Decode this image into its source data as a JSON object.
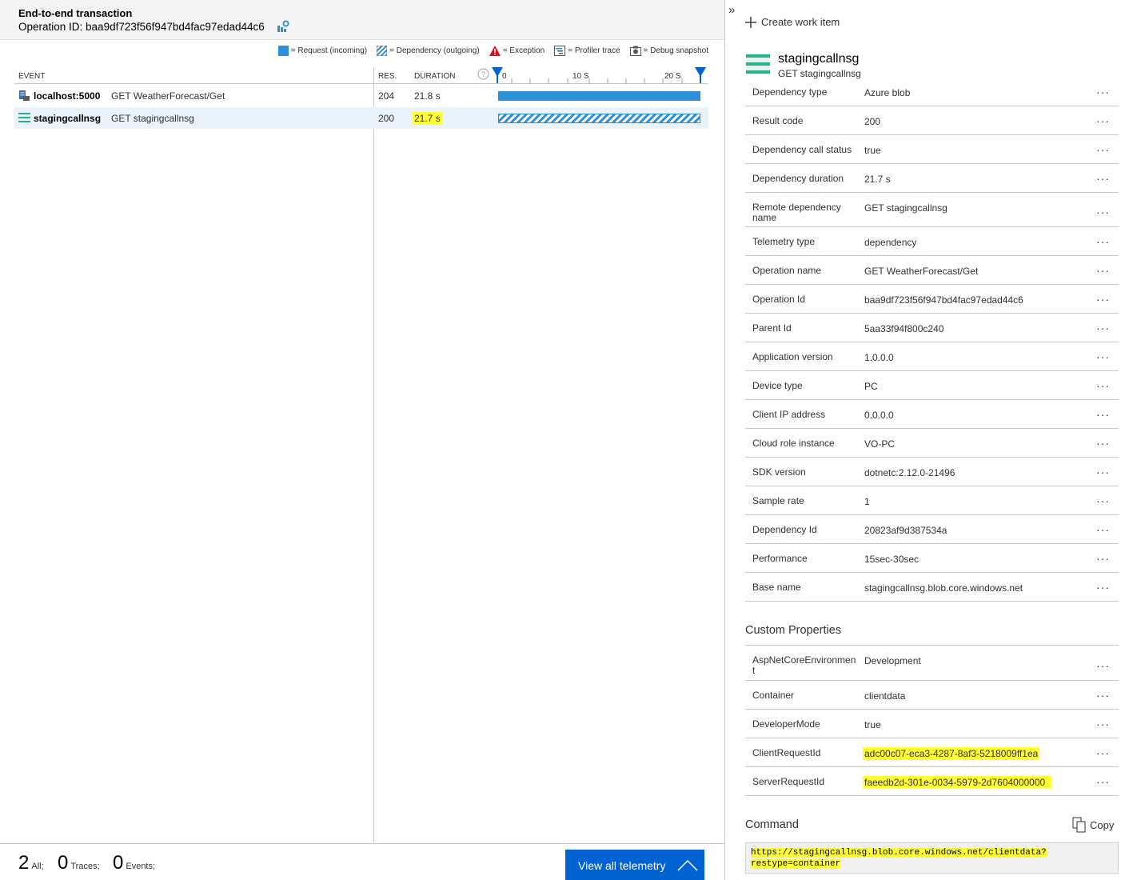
{
  "header": {
    "title": "End-to-end transaction",
    "operation_label": "Operation ID: baa9df723f56f947bd4fac97edad44c6"
  },
  "legend": {
    "request": "= Request (incoming)",
    "dependency": "= Dependency (outgoing)",
    "exception": "= Exception",
    "profiler": "= Profiler trace",
    "snapshot": "= Debug snapshot"
  },
  "columns": {
    "event": "EVENT",
    "res": "RES.",
    "duration": "DURATION",
    "tick0": "0",
    "tick10": "10 S",
    "tick20": "20 S"
  },
  "rows": [
    {
      "source": "localhost:5000",
      "name": "GET WeatherForecast/Get",
      "res": "204",
      "duration": "21.8 s",
      "icon": "server-icon"
    },
    {
      "source": "stagingcallnsg",
      "name": "GET stagingcallnsg",
      "res": "200",
      "duration": "21.7 s",
      "icon": "storage-icon"
    }
  ],
  "footer": {
    "all_count": "2",
    "all_label": "All;",
    "traces_count": "0",
    "traces_label": "Traces;",
    "events_count": "0",
    "events_label": "Events;",
    "view_all": "View all telemetry"
  },
  "details": {
    "create_work_item": "Create work item",
    "title": "stagingcallnsg",
    "subtitle": "GET stagingcallnsg",
    "properties": [
      {
        "key": "Dependency type",
        "value": "Azure blob"
      },
      {
        "key": "Result code",
        "value": "200"
      },
      {
        "key": "Dependency call status",
        "value": "true"
      },
      {
        "key": "Dependency duration",
        "value": "21.7 s"
      },
      {
        "key": "Remote dependency name",
        "value": "GET stagingcallnsg"
      },
      {
        "key": "Telemetry type",
        "value": "dependency"
      },
      {
        "key": "Operation name",
        "value": "GET WeatherForecast/Get"
      },
      {
        "key": "Operation Id",
        "value": "baa9df723f56f947bd4fac97edad44c6"
      },
      {
        "key": "Parent Id",
        "value": "5aa33f94f800c240"
      },
      {
        "key": "Application version",
        "value": "1.0.0.0"
      },
      {
        "key": "Device type",
        "value": "PC"
      },
      {
        "key": "Client IP address",
        "value": "0.0.0.0"
      },
      {
        "key": "Cloud role instance",
        "value": "VO-PC"
      },
      {
        "key": "SDK version",
        "value": "dotnetc:2.12.0-21496"
      },
      {
        "key": "Sample rate",
        "value": "1"
      },
      {
        "key": "Dependency Id",
        "value": "20823af9d387534a"
      },
      {
        "key": "Performance",
        "value": "15sec-30sec"
      },
      {
        "key": "Base name",
        "value": "stagingcallnsg.blob.core.windows.net"
      }
    ],
    "custom_heading": "Custom Properties",
    "custom_properties": [
      {
        "key": "AspNetCoreEnvironment",
        "value": "Development"
      },
      {
        "key": "Container",
        "value": "clientdata"
      },
      {
        "key": "DeveloperMode",
        "value": "true"
      },
      {
        "key": "ClientRequestId",
        "value": "adc00c07-eca3-4287-8af3-5218009ff1ea"
      },
      {
        "key": "ServerRequestId",
        "value": "faeedb2d-301e-0034-5979-2d7604000000"
      }
    ],
    "command_heading": "Command",
    "copy_label": "Copy",
    "command_line1": "https://stagingcallnsg.blob.core.windows.net/clientdata?",
    "command_line2": "restype=container",
    "more": "···"
  },
  "colors": {
    "request_bar": "#2e8fd9",
    "dependency_bar": "#2e8fd9",
    "selected_row": "#eaf3fb",
    "highlight": "#ffff33",
    "button": "#0063d1"
  }
}
